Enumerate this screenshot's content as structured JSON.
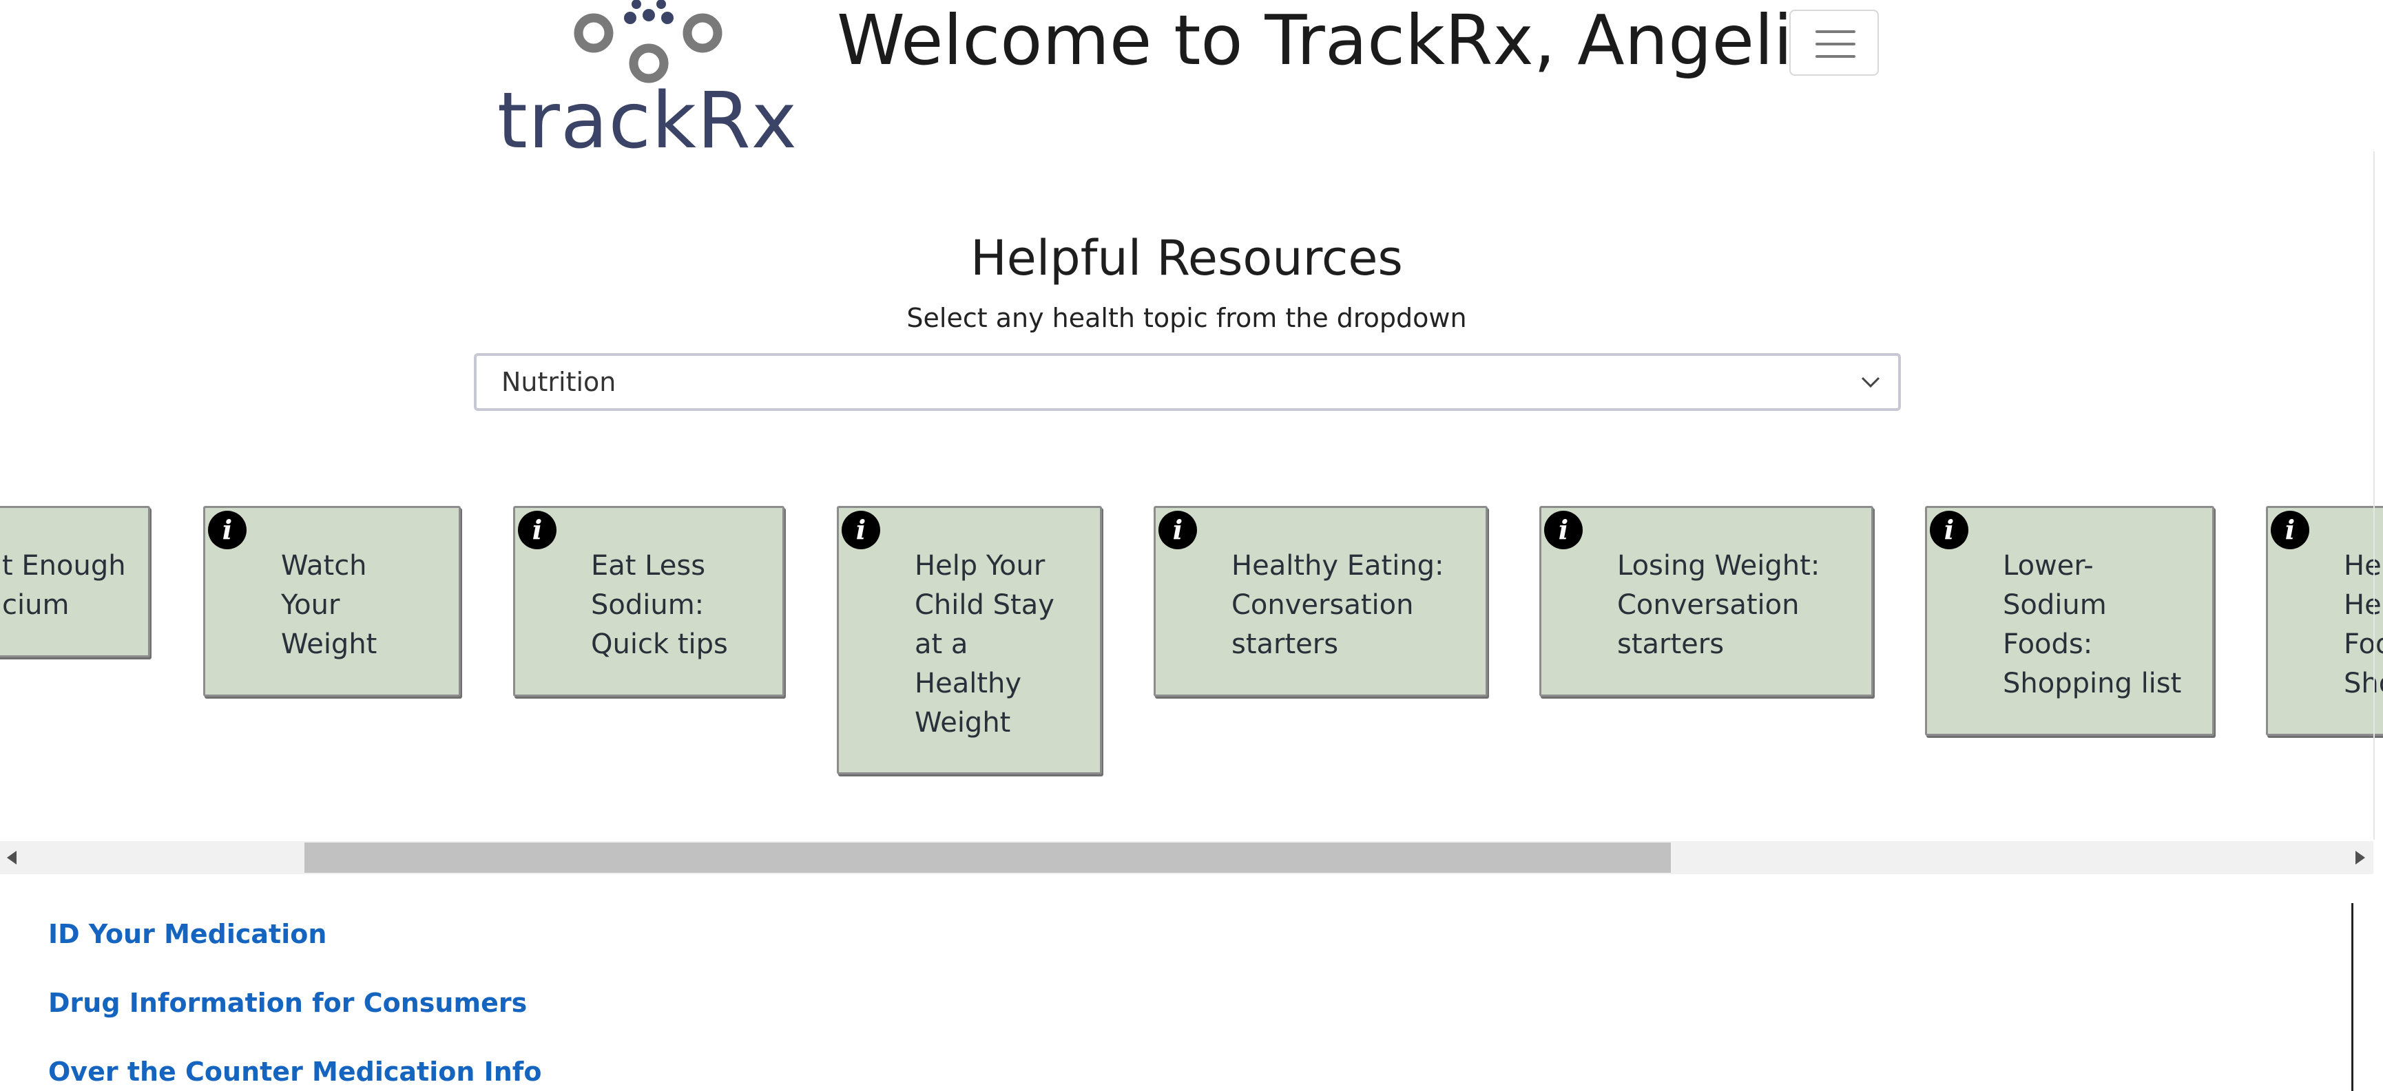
{
  "header": {
    "logo_text": "trackRx",
    "welcome": "Welcome to TrackRx, Angelica"
  },
  "resources": {
    "title": "Helpful Resources",
    "subtitle": "Select any health topic from the dropdown",
    "dropdown_value": "Nutrition"
  },
  "cards": [
    {
      "lines": [
        "t Enough",
        "cium"
      ]
    },
    {
      "lines": [
        "Watch",
        "Your",
        "Weight"
      ]
    },
    {
      "lines": [
        "Eat Less",
        "Sodium:",
        "Quick tips"
      ]
    },
    {
      "lines": [
        "Help Your",
        "Child Stay",
        "at a",
        "Healthy",
        "Weight"
      ]
    },
    {
      "lines": [
        "Healthy Eating:",
        "Conversation",
        "starters"
      ]
    },
    {
      "lines": [
        "Losing Weight:",
        "Conversation",
        "starters"
      ]
    },
    {
      "lines": [
        "Lower-",
        "Sodium",
        "Foods:",
        "Shopping list"
      ]
    },
    {
      "lines": [
        "He",
        "He",
        "Foo",
        "Sho"
      ]
    }
  ],
  "info_glyph": "i",
  "links": [
    "ID Your Medication",
    "Drug Information for Consumers",
    "Over the Counter Medication Info"
  ],
  "colors": {
    "card_bg": "#d1dbc9",
    "link": "#1565c0",
    "logo_text": "#3b4466"
  },
  "icons": {
    "menu": "hamburger-icon",
    "dropdown": "chevron-down-icon",
    "info": "info-icon"
  }
}
